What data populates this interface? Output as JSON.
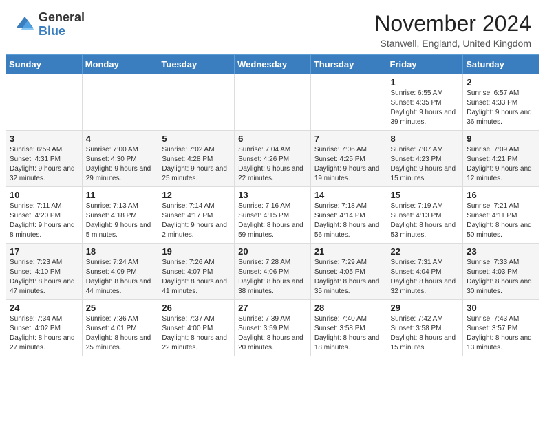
{
  "logo": {
    "general": "General",
    "blue": "Blue"
  },
  "header": {
    "month": "November 2024",
    "location": "Stanwell, England, United Kingdom"
  },
  "weekdays": [
    "Sunday",
    "Monday",
    "Tuesday",
    "Wednesday",
    "Thursday",
    "Friday",
    "Saturday"
  ],
  "weeks": [
    [
      {
        "day": "",
        "info": ""
      },
      {
        "day": "",
        "info": ""
      },
      {
        "day": "",
        "info": ""
      },
      {
        "day": "",
        "info": ""
      },
      {
        "day": "",
        "info": ""
      },
      {
        "day": "1",
        "info": "Sunrise: 6:55 AM\nSunset: 4:35 PM\nDaylight: 9 hours and 39 minutes."
      },
      {
        "day": "2",
        "info": "Sunrise: 6:57 AM\nSunset: 4:33 PM\nDaylight: 9 hours and 36 minutes."
      }
    ],
    [
      {
        "day": "3",
        "info": "Sunrise: 6:59 AM\nSunset: 4:31 PM\nDaylight: 9 hours and 32 minutes."
      },
      {
        "day": "4",
        "info": "Sunrise: 7:00 AM\nSunset: 4:30 PM\nDaylight: 9 hours and 29 minutes."
      },
      {
        "day": "5",
        "info": "Sunrise: 7:02 AM\nSunset: 4:28 PM\nDaylight: 9 hours and 25 minutes."
      },
      {
        "day": "6",
        "info": "Sunrise: 7:04 AM\nSunset: 4:26 PM\nDaylight: 9 hours and 22 minutes."
      },
      {
        "day": "7",
        "info": "Sunrise: 7:06 AM\nSunset: 4:25 PM\nDaylight: 9 hours and 19 minutes."
      },
      {
        "day": "8",
        "info": "Sunrise: 7:07 AM\nSunset: 4:23 PM\nDaylight: 9 hours and 15 minutes."
      },
      {
        "day": "9",
        "info": "Sunrise: 7:09 AM\nSunset: 4:21 PM\nDaylight: 9 hours and 12 minutes."
      }
    ],
    [
      {
        "day": "10",
        "info": "Sunrise: 7:11 AM\nSunset: 4:20 PM\nDaylight: 9 hours and 8 minutes."
      },
      {
        "day": "11",
        "info": "Sunrise: 7:13 AM\nSunset: 4:18 PM\nDaylight: 9 hours and 5 minutes."
      },
      {
        "day": "12",
        "info": "Sunrise: 7:14 AM\nSunset: 4:17 PM\nDaylight: 9 hours and 2 minutes."
      },
      {
        "day": "13",
        "info": "Sunrise: 7:16 AM\nSunset: 4:15 PM\nDaylight: 8 hours and 59 minutes."
      },
      {
        "day": "14",
        "info": "Sunrise: 7:18 AM\nSunset: 4:14 PM\nDaylight: 8 hours and 56 minutes."
      },
      {
        "day": "15",
        "info": "Sunrise: 7:19 AM\nSunset: 4:13 PM\nDaylight: 8 hours and 53 minutes."
      },
      {
        "day": "16",
        "info": "Sunrise: 7:21 AM\nSunset: 4:11 PM\nDaylight: 8 hours and 50 minutes."
      }
    ],
    [
      {
        "day": "17",
        "info": "Sunrise: 7:23 AM\nSunset: 4:10 PM\nDaylight: 8 hours and 47 minutes."
      },
      {
        "day": "18",
        "info": "Sunrise: 7:24 AM\nSunset: 4:09 PM\nDaylight: 8 hours and 44 minutes."
      },
      {
        "day": "19",
        "info": "Sunrise: 7:26 AM\nSunset: 4:07 PM\nDaylight: 8 hours and 41 minutes."
      },
      {
        "day": "20",
        "info": "Sunrise: 7:28 AM\nSunset: 4:06 PM\nDaylight: 8 hours and 38 minutes."
      },
      {
        "day": "21",
        "info": "Sunrise: 7:29 AM\nSunset: 4:05 PM\nDaylight: 8 hours and 35 minutes."
      },
      {
        "day": "22",
        "info": "Sunrise: 7:31 AM\nSunset: 4:04 PM\nDaylight: 8 hours and 32 minutes."
      },
      {
        "day": "23",
        "info": "Sunrise: 7:33 AM\nSunset: 4:03 PM\nDaylight: 8 hours and 30 minutes."
      }
    ],
    [
      {
        "day": "24",
        "info": "Sunrise: 7:34 AM\nSunset: 4:02 PM\nDaylight: 8 hours and 27 minutes."
      },
      {
        "day": "25",
        "info": "Sunrise: 7:36 AM\nSunset: 4:01 PM\nDaylight: 8 hours and 25 minutes."
      },
      {
        "day": "26",
        "info": "Sunrise: 7:37 AM\nSunset: 4:00 PM\nDaylight: 8 hours and 22 minutes."
      },
      {
        "day": "27",
        "info": "Sunrise: 7:39 AM\nSunset: 3:59 PM\nDaylight: 8 hours and 20 minutes."
      },
      {
        "day": "28",
        "info": "Sunrise: 7:40 AM\nSunset: 3:58 PM\nDaylight: 8 hours and 18 minutes."
      },
      {
        "day": "29",
        "info": "Sunrise: 7:42 AM\nSunset: 3:58 PM\nDaylight: 8 hours and 15 minutes."
      },
      {
        "day": "30",
        "info": "Sunrise: 7:43 AM\nSunset: 3:57 PM\nDaylight: 8 hours and 13 minutes."
      }
    ]
  ]
}
